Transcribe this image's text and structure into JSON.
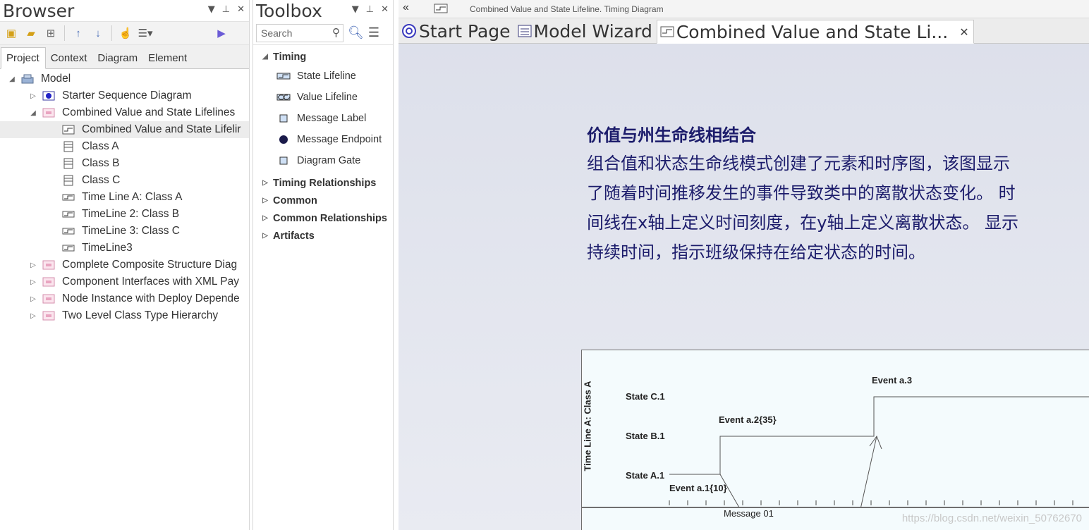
{
  "browser": {
    "title": "Browser",
    "tabs": [
      "Project",
      "Context",
      "Diagram",
      "Element"
    ],
    "tree": [
      {
        "label": "Model",
        "icon": "model-icon",
        "expanded": true
      },
      {
        "label": "Starter Sequence Diagram",
        "icon": "package-icon"
      },
      {
        "label": "Combined Value and State Lifelines",
        "icon": "package-icon",
        "expanded": true
      },
      {
        "label": "Combined Value and State Lifelir",
        "icon": "timing-diagram-icon",
        "selected": true
      },
      {
        "label": "Class A",
        "icon": "class-icon"
      },
      {
        "label": "Class B",
        "icon": "class-icon"
      },
      {
        "label": "Class C",
        "icon": "class-icon"
      },
      {
        "label": "Time Line A: Class A",
        "icon": "timeline-icon"
      },
      {
        "label": "TimeLine 2: Class B",
        "icon": "timeline-icon"
      },
      {
        "label": "TimeLine 3: Class C",
        "icon": "timeline-icon"
      },
      {
        "label": "TimeLine3",
        "icon": "timeline-icon"
      },
      {
        "label": "Complete Composite Structure Diag",
        "icon": "package-icon"
      },
      {
        "label": "Component Interfaces with XML Pay",
        "icon": "package-icon"
      },
      {
        "label": "Node Instance with Deploy Depende",
        "icon": "package-icon"
      },
      {
        "label": "Two Level Class Type Hierarchy",
        "icon": "package-icon"
      }
    ]
  },
  "toolbox": {
    "title": "Toolbox",
    "search_placeholder": "Search",
    "section_timing": "Timing",
    "items": [
      "State Lifeline",
      "Value Lifeline",
      "Message Label",
      "Message Endpoint",
      "Diagram Gate"
    ],
    "sections": [
      "Timing Relationships",
      "Common",
      "Common Relationships",
      "Artifacts"
    ]
  },
  "main": {
    "header_path": "Combined Value and State Lifeline.  Timing Diagram",
    "tabs": [
      "Start Page",
      "Model Wizard",
      "Combined Value and State Li..."
    ],
    "note_title": "价值与州生命线相结合",
    "note_body": "组合值和状态生命线模式创建了元素和时序图，该图显示了随着时间推移发生的事件导致类中的离散状态变化。 时间线在x轴上定义时间刻度，在y轴上定义离散状态。 显示持续时间，指示班级保持在给定状态的时间。"
  },
  "diagram": {
    "lifeline_label": "Time Line A: Class A",
    "states": [
      "State C.1",
      "State B.1",
      "State A.1"
    ],
    "events": [
      "Event a.3",
      "Event a.2{35}",
      "Event a.1{10}"
    ],
    "message": "Message 01"
  },
  "watermark": "https://blog.csdn.net/weixin_50762670",
  "colors": {
    "accent": "#1c1c6b",
    "frame_bg": "#f4fbfd",
    "canvas_bg": "#e3e5ee"
  }
}
